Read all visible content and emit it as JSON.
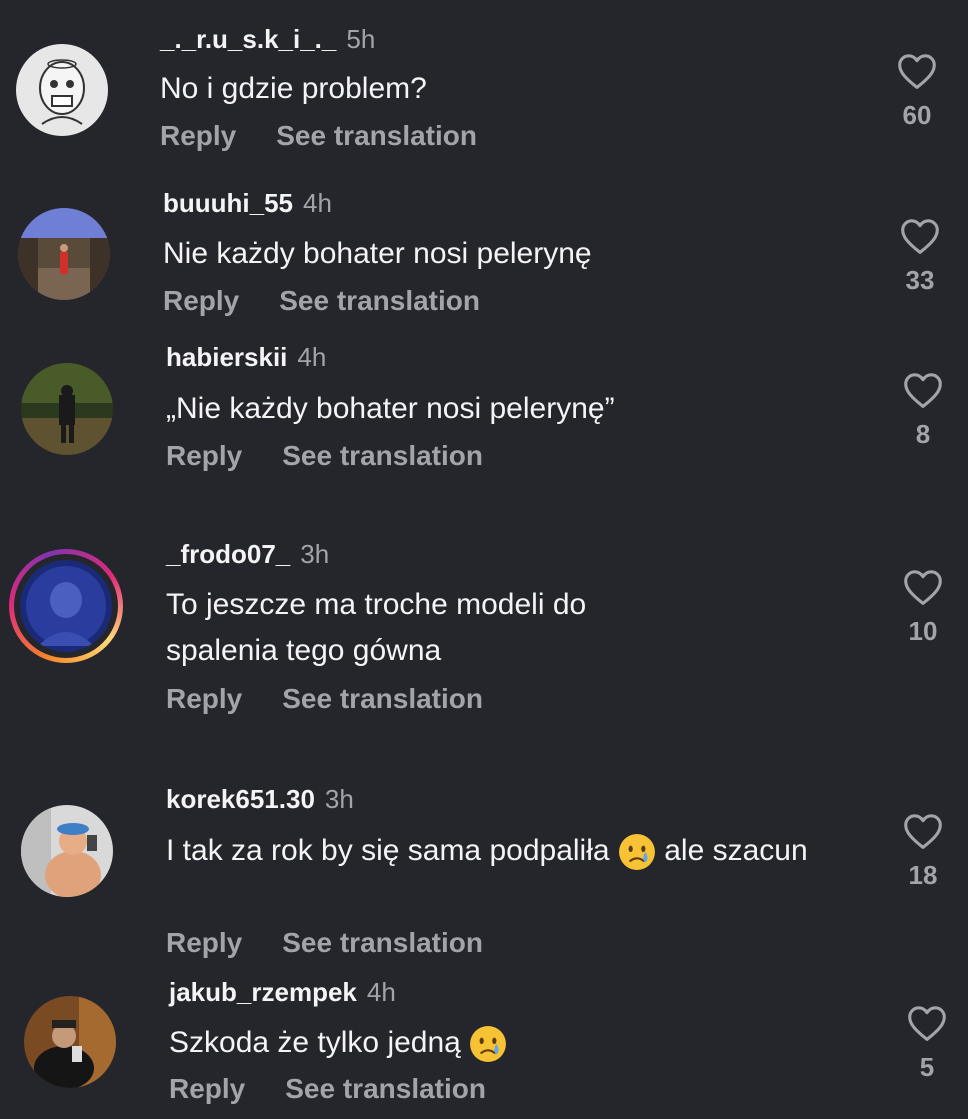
{
  "comments": [
    {
      "username": "_._r.u_s.k_i_._",
      "time": "5h",
      "text": "No i gdzie problem?",
      "likes": "60",
      "reply": "Reply",
      "translate": "See translation"
    },
    {
      "username": "buuuhi_55",
      "time": "4h",
      "text": "Nie każdy bohater nosi pelerynę",
      "likes": "33",
      "reply": "Reply",
      "translate": "See translation"
    },
    {
      "username": "habierskii",
      "time": "4h",
      "text": "„Nie każdy bohater nosi pelerynę”",
      "likes": "8",
      "reply": "Reply",
      "translate": "See translation"
    },
    {
      "username": "_frodo07_",
      "time": "3h",
      "text": "To jeszcze ma troche modeli do spalenia tego gówna",
      "likes": "10",
      "reply": "Reply",
      "translate": "See translation"
    },
    {
      "username": "korek651.30",
      "time": "3h",
      "text_a": "I tak za rok by się sama podpaliła",
      "text_b": "ale szacun",
      "likes": "18",
      "reply": "Reply",
      "translate": "See translation"
    },
    {
      "username": "jakub_rzempek",
      "time": "4h",
      "text_a": "Szkoda że tylko jedną",
      "likes": "5",
      "reply": "Reply",
      "translate": "See translation"
    }
  ],
  "colors": {
    "background": "#25262b",
    "muted": "#a3a4aa",
    "text": "#f4f4f6"
  },
  "icons": {
    "like": "heart-outline-icon",
    "emoji": "crying-face-emoji"
  }
}
